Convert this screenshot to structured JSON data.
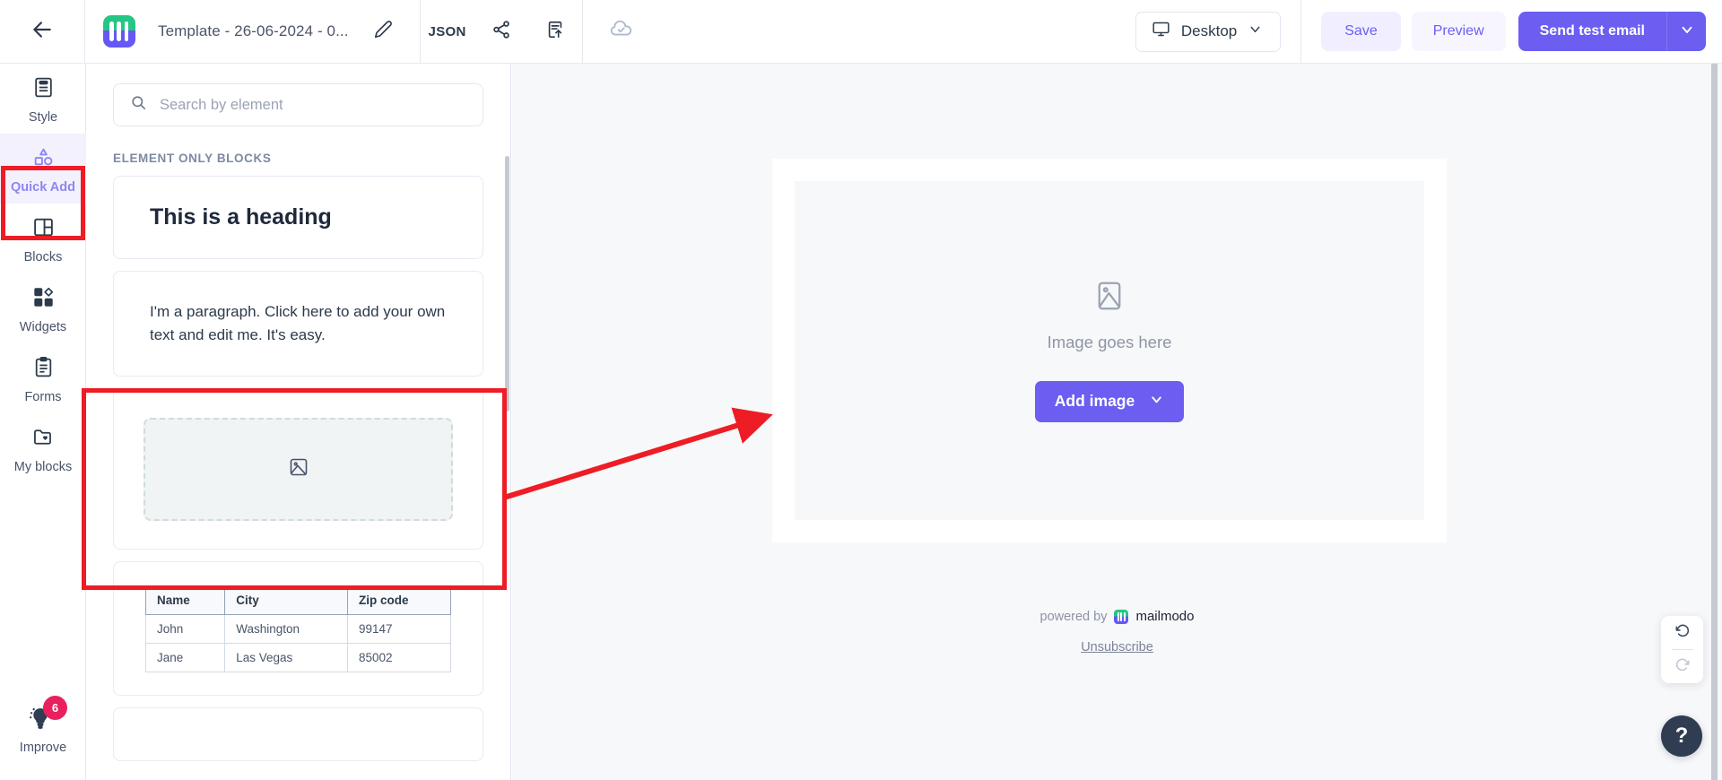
{
  "topbar": {
    "back_icon": "arrow-left-icon",
    "brand_logo": "mailmodo-logo",
    "template_name": "Template - 26-06-2024 - 0...",
    "edit_icon": "pencil-icon",
    "json_label": "JSON",
    "share_icon": "share-icon",
    "export_icon": "export-document-icon",
    "cloud_icon": "cloud-saved-icon",
    "device": {
      "label": "Desktop",
      "icon": "monitor-icon",
      "caret": "chevron-down-icon"
    },
    "save_label": "Save",
    "preview_label": "Preview",
    "send_test_label": "Send test email",
    "send_test_caret": "chevron-down-icon"
  },
  "rail": {
    "items": [
      {
        "label": "Style",
        "icon": "style-icon",
        "active": false
      },
      {
        "label": "Quick Add",
        "icon": "shapes-icon",
        "active": true
      },
      {
        "label": "Blocks",
        "icon": "layout-icon",
        "active": false
      },
      {
        "label": "Widgets",
        "icon": "widgets-icon",
        "active": false
      },
      {
        "label": "Forms",
        "icon": "clipboard-icon",
        "active": false
      },
      {
        "label": "My blocks",
        "icon": "folder-heart-icon",
        "active": false
      }
    ],
    "improve": {
      "label": "Improve",
      "icon": "lightbulb-icon",
      "badge": "6"
    }
  },
  "panel": {
    "search": {
      "placeholder": "Search by element",
      "value": "",
      "icon": "search-icon"
    },
    "section_title": "ELEMENT ONLY BLOCKS",
    "blocks": {
      "heading": {
        "name": "heading-block",
        "text": "This is a heading"
      },
      "paragraph": {
        "name": "paragraph-block",
        "text": "I'm a paragraph. Click here to add your own text and edit me. It's easy."
      },
      "image": {
        "name": "image-block",
        "icon": "image-placeholder-icon"
      },
      "table": {
        "name": "table-block",
        "columns": [
          "Name",
          "City",
          "Zip code"
        ],
        "rows": [
          [
            "John",
            "Washington",
            "99147"
          ],
          [
            "Jane",
            "Las Vegas",
            "85002"
          ]
        ]
      }
    }
  },
  "canvas": {
    "image_block": {
      "icon": "image-placeholder-icon",
      "caption": "Image goes here",
      "button_label": "Add image",
      "button_caret": "chevron-down-icon"
    },
    "footer": {
      "powered_by": "powered by",
      "brand": "mailmodo",
      "unsubscribe": "Unsubscribe"
    }
  },
  "floating": {
    "undo_icon": "undo-icon",
    "redo_icon": "redo-icon",
    "help_label": "?"
  },
  "annotations": {
    "highlight_rail_item": "Quick Add",
    "highlight_block": "image-block",
    "arrow": "points from image block in panel to image block on canvas",
    "color": "#ee1c25"
  },
  "colors": {
    "accent": "#6b5ef0",
    "accent_soft": "#f1efff",
    "badge": "#e8215e",
    "canvas_bg": "#f7f8fa",
    "text_dark": "#2c3a4b",
    "annotation_red": "#ee1c25"
  }
}
